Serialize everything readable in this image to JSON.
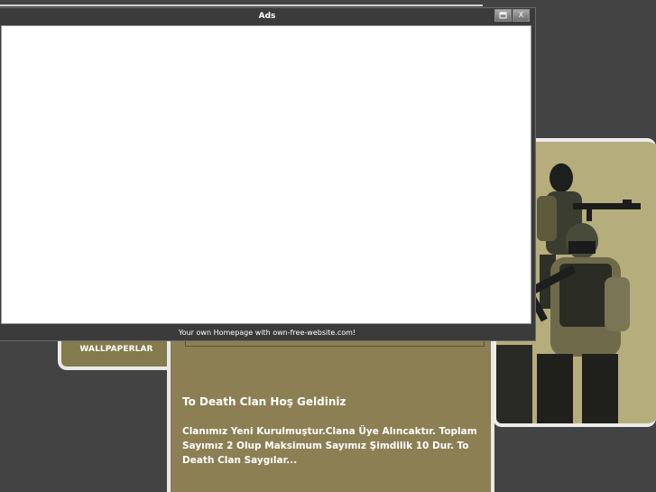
{
  "ads": {
    "title": "Ads",
    "footer": "Your own Homepage with own-free-website.com!",
    "controls": {
      "minimize_icon": "window-icon",
      "close_symbol": "X"
    }
  },
  "nav": {
    "items": [
      {
        "label": "WALLPAPERLAR"
      }
    ]
  },
  "main": {
    "welcome": "To Death Clan Hoş Geldiniz",
    "intro": "Clanımız Yeni Kurulmuştur.Clana Üye Alıncaktır. Toplam Sayımız 2 Olup Maksimum Sayımız Şimdilik 10 Dur. To Death Clan Saygılar..."
  },
  "header_image": {
    "subject": "counter-terrorist-soldiers-image"
  },
  "colors": {
    "page_bg": "#434343",
    "panel_olive": "#8c7f53",
    "nav_olive": "#837a4d",
    "border_light": "#e9e9e9",
    "image_bg": "#b6ad7c"
  }
}
